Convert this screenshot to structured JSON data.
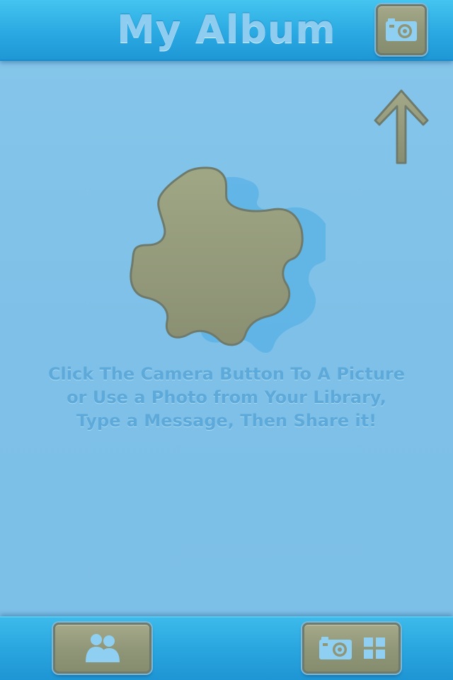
{
  "header": {
    "title": "My Album",
    "camera_icon": "camera-icon"
  },
  "main": {
    "hint_arrow_icon": "arrow-up-icon",
    "placeholder_icon": "puzzle-piece-icon",
    "instructions": [
      "Click The Camera Button To A Picture",
      "or Use a Photo from Your Library,",
      "Type a Message, Then Share it!"
    ]
  },
  "footer": {
    "left_button_icon": "people-icon",
    "right_button_icons": [
      "camera-icon",
      "grid-icon"
    ]
  },
  "colors": {
    "header_bar": "#2aa9e2",
    "background": "#7ec0e7",
    "button_fill": "#8f9577",
    "button_border": "#6e7b6c",
    "icon_light": "#8fd0f2",
    "instruction_text": "#5da9d9"
  }
}
